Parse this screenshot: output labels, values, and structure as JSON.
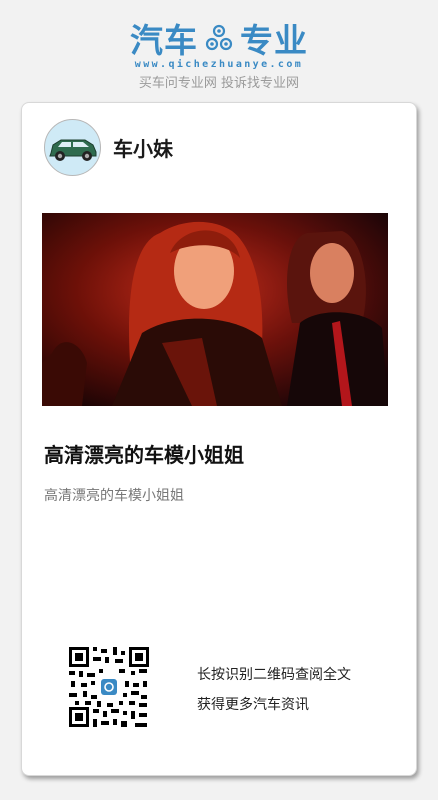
{
  "header": {
    "logo_left": "汽车",
    "logo_right": "专业",
    "logo_url": "www.qichezhuanye.com",
    "slogan": "买车问专业网 投诉找专业网",
    "gear_icon": "gear-icon"
  },
  "colors": {
    "brand_blue": "#3a8ac4",
    "background": "#f2f2f2",
    "card": "#ffffff",
    "avatar_bg": "#cfeaf6"
  },
  "post": {
    "author": "车小妹",
    "avatar_icon": "car-icon",
    "title": "高清漂亮的车模小姐姐",
    "summary": "高清漂亮的车模小姐姐"
  },
  "qr": {
    "icon": "qr-code-icon",
    "line1": "长按识别二维码查阅全文",
    "line2": "获得更多汽车资讯"
  }
}
